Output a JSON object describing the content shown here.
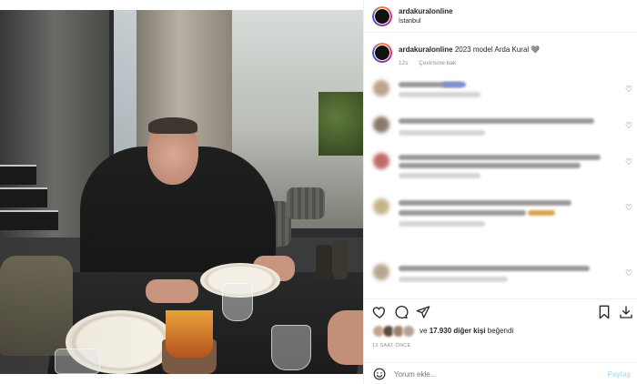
{
  "header": {
    "username": "ardakuralonline",
    "location": "İstanbul"
  },
  "caption": {
    "username": "ardakuralonline",
    "text": "2023 model Arda Kural 🩶",
    "age": "12s",
    "translate": "Çevirisine bak"
  },
  "comments": [
    {
      "avatar_color": "#b9a38c",
      "lines": 2
    },
    {
      "avatar_color": "#8a7a6a",
      "lines": 2
    },
    {
      "avatar_color": "#c06a6a",
      "lines": 2
    },
    {
      "avatar_color": "#c9b48a",
      "lines": 2
    },
    {
      "avatar_color": "#b8a690",
      "lines": 2
    }
  ],
  "likes": {
    "count_text": "17.930 diğer kişi",
    "prefix": "ve",
    "suffix": "beğendi"
  },
  "timestamp": "12 SAAT ÖNCE",
  "add_comment": {
    "placeholder": "Yorum ekle...",
    "post_label": "Paylaş"
  },
  "icons": {
    "like": "heart-icon",
    "comment": "comment-icon",
    "share": "share-icon",
    "save": "bookmark-icon",
    "download": "download-icon",
    "emoji": "emoji-icon"
  },
  "colors": {
    "accent_disabled": "#b2dffc",
    "muted_text": "#8e8e8e",
    "text": "#262626"
  }
}
